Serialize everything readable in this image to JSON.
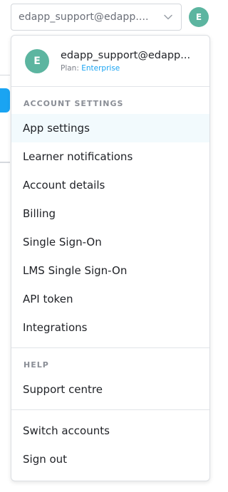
{
  "topbar": {
    "account_select_value": "edapp_support@edapp....",
    "avatar_initial": "E"
  },
  "menu": {
    "user_email": "edapp_support@edapp...",
    "plan_label": "Plan:",
    "plan_value": "Enterprise",
    "avatar_initial": "E",
    "account_section_title": "ACCOUNT SETTINGS",
    "account_items": [
      {
        "label": "App settings"
      },
      {
        "label": "Learner notifications"
      },
      {
        "label": "Account details"
      },
      {
        "label": "Billing"
      },
      {
        "label": "Single Sign-On"
      },
      {
        "label": "LMS Single Sign-On"
      },
      {
        "label": "API token"
      },
      {
        "label": "Integrations"
      }
    ],
    "help_section_title": "HELP",
    "help_items": [
      {
        "label": "Support centre"
      }
    ],
    "footer_items": [
      {
        "label": "Switch accounts"
      },
      {
        "label": "Sign out"
      }
    ]
  },
  "colors": {
    "accent": "#1aa4f2",
    "avatar": "#5cb5a0",
    "active_row": "#f2fafd"
  },
  "icons": {
    "select_chevron": "chevron-down-icon"
  }
}
